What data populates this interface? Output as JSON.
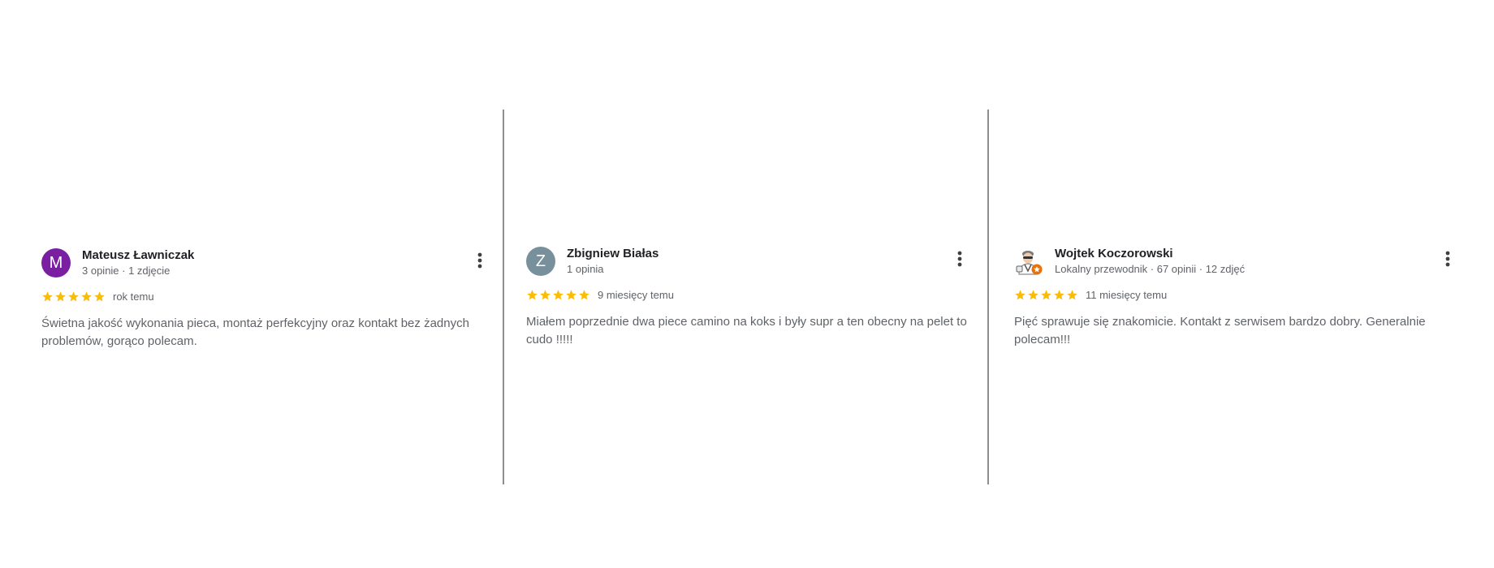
{
  "theme": {
    "star_color": "#fbbc04",
    "divider_color": "#8e8e8e",
    "text_color": "#5f6368",
    "name_color": "#202124"
  },
  "reviews": [
    {
      "author": "Mateusz Ławniczak",
      "avatar_initial": "M",
      "avatar_color": "#7b1fa2",
      "meta": "3 opinie · 1 zdjęcie",
      "rating": 5,
      "date": "rok temu",
      "text": "Świetna jakość wykonania pieca, montaż perfekcyjny oraz kontakt bez żadnych problemów, gorąco polecam.",
      "more_icon": "more-vert-icon"
    },
    {
      "author": "Zbigniew Białas",
      "avatar_initial": "Z",
      "avatar_color": "#78909c",
      "meta": "1 opinia",
      "rating": 5,
      "date": "9 miesięcy temu",
      "text": "Miałem poprzednie dwa piece camino na koks i były supr a ten obecny na pelet to cudo !!!!!",
      "more_icon": "more-vert-icon"
    },
    {
      "author": "Wojtek Koczorowski",
      "avatar_icon": "local-guide-avatar-icon",
      "meta": "Lokalny przewodnik · 67 opinii · 12 zdjęć",
      "rating": 5,
      "date": "11 miesięcy temu",
      "text": "Pięć sprawuje się znakomicie. Kontakt z serwisem bardzo dobry. Generalnie polecam!!!",
      "more_icon": "more-vert-icon"
    }
  ]
}
